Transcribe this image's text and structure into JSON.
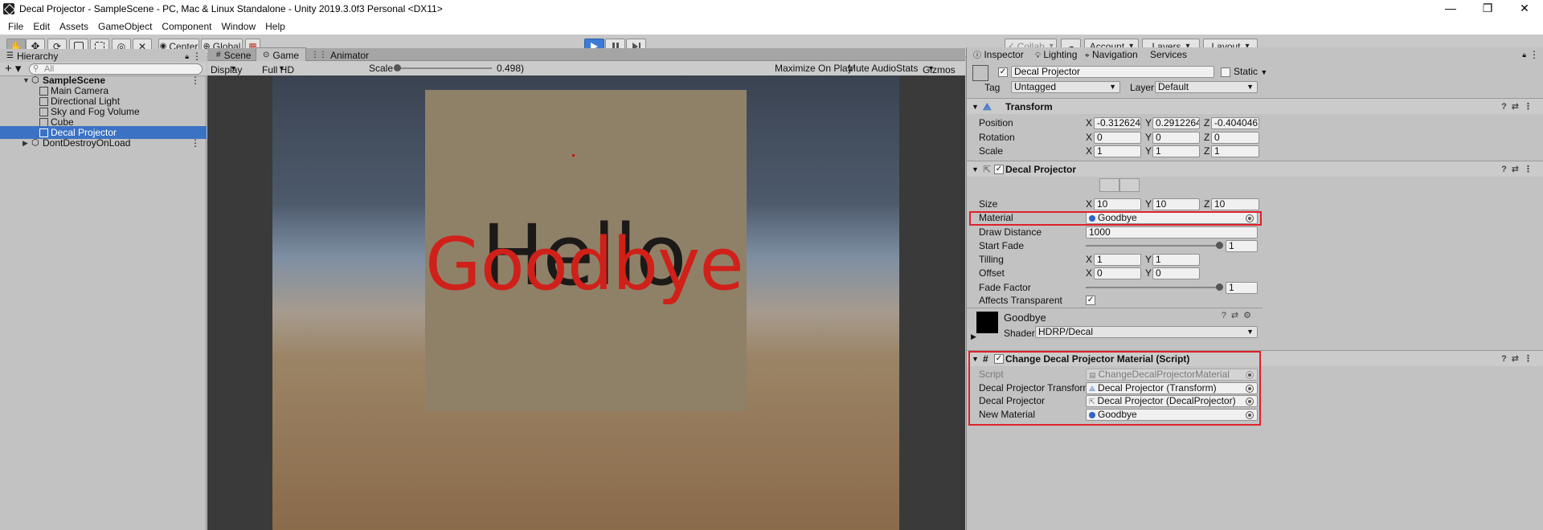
{
  "window": {
    "title": "Decal Projector - SampleScene - PC, Mac & Linux Standalone - Unity 2019.3.0f3 Personal <DX11>",
    "minimize": "—",
    "maximize": "❐",
    "close": "✕"
  },
  "menu": [
    "File",
    "Edit",
    "Assets",
    "GameObject",
    "Component",
    "Window",
    "Help"
  ],
  "toolbar": {
    "pivot_mode": "Center",
    "pivot_rotation": "Global",
    "collab": "Collab",
    "account": "Account",
    "layers": "Layers",
    "layout": "Layout"
  },
  "hierarchy": {
    "tab": "Hierarchy",
    "search_placeholder": "All",
    "scene": "SampleScene",
    "items": [
      "Main Camera",
      "Directional Light",
      "Sky and Fog Volume",
      "Cube",
      "Decal Projector"
    ],
    "selected": "Decal Projector",
    "dont_destroy": "DontDestroyOnLoad"
  },
  "game_view": {
    "tabs": [
      "Scene",
      "Game",
      "Animator"
    ],
    "active_tab": "Game",
    "display": "Display 1",
    "resolution": "Full HD (1920x1080)",
    "scale_label": "Scale",
    "scale_value": "0.498)",
    "maximize_on_play": "Maximize On Play",
    "mute_audio": "Mute Audio",
    "stats": "Stats",
    "gizmos": "Gizmos",
    "text_hello": "Hello",
    "text_goodbye": "Goodbye"
  },
  "inspector": {
    "tabs": [
      "Inspector",
      "Lighting",
      "Navigation",
      "Services"
    ],
    "object_name": "Decal Projector",
    "static_label": "Static",
    "tag_label": "Tag",
    "tag_value": "Untagged",
    "layer_label": "Layer",
    "layer_value": "Default",
    "transform": {
      "header": "Transform",
      "position_label": "Position",
      "position": [
        "-0.3126241",
        "0.2912264",
        "-0.4040467"
      ],
      "rotation_label": "Rotation",
      "rotation": [
        "0",
        "0",
        "0"
      ],
      "scale_label": "Scale",
      "scale": [
        "1",
        "1",
        "1"
      ]
    },
    "decal_projector": {
      "header": "Decal Projector",
      "size_label": "Size",
      "size": [
        "10",
        "10",
        "10"
      ],
      "material_label": "Material",
      "material_value": "Goodbye",
      "draw_distance_label": "Draw Distance",
      "draw_distance": "1000",
      "start_fade_label": "Start Fade",
      "start_fade": "1",
      "start_fade_level": 1.0,
      "tilling_label": "Tilling",
      "tilling": [
        "1",
        "1"
      ],
      "offset_label": "Offset",
      "offset": [
        "0",
        "0"
      ],
      "fade_factor_label": "Fade Factor",
      "fade_factor": "1",
      "fade_factor_level": 1.0,
      "affects_transparent_label": "Affects Transparent"
    },
    "material": {
      "name": "Goodbye",
      "shader_label": "Shader",
      "shader_value": "HDRP/Decal"
    },
    "script_component": {
      "header": "Change Decal Projector Material (Script)",
      "script_label": "Script",
      "script_value": "ChangeDecalProjectorMaterial",
      "transform_label": "Decal Projector Transform",
      "transform_value": "Decal Projector (Transform)",
      "projector_label": "Decal Projector",
      "projector_value": "Decal Projector (DecalProjector)",
      "new_material_label": "New Material",
      "new_material_value": "Goodbye"
    },
    "axes": [
      "X",
      "Y",
      "Z"
    ]
  },
  "colors": {
    "accent": "#3b72c4",
    "highlight_box": "#e0202b",
    "goodbye_text": "#d0201a"
  }
}
